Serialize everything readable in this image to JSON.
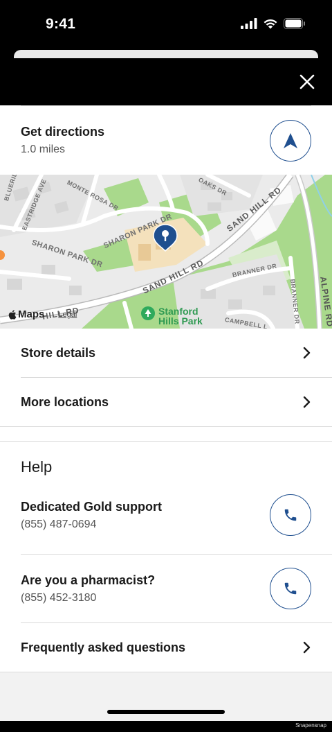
{
  "status_bar": {
    "time": "9:41"
  },
  "directions": {
    "title": "Get directions",
    "distance": "1.0 miles"
  },
  "map": {
    "labels": {
      "blueridge": "BLUERIDGE AVE",
      "eastridge": "EASTRIDGE AVE",
      "monte_rosa": "MONTE ROSA DR",
      "oaks": "OAKS DR",
      "sharon_park_1": "SHARON PARK DR",
      "sharon_park_2": "SHARON PARK DR",
      "sand_hill_1": "SAND HILL RD",
      "sand_hill_2": "SAND HILL RD",
      "sand_hill_3": "HILL RD",
      "branner_1": "BRANNER DR",
      "branner_2": "BRANNER DR",
      "campbell": "CAMPBELL L",
      "alpine": "ALPINE RD",
      "park_line1": "Stanford",
      "park_line2": "Hills Park"
    },
    "attribution": {
      "maps": "Maps",
      "legal": "Legal"
    }
  },
  "menu": {
    "store_details": "Store details",
    "more_locations": "More locations"
  },
  "help": {
    "heading": "Help",
    "gold_support": {
      "title": "Dedicated Gold support",
      "phone": "(855) 487-0694"
    },
    "pharmacist": {
      "title": "Are you a pharmacist?",
      "phone": "(855) 452-3180"
    },
    "faq": "Frequently asked questions"
  },
  "footer": {
    "watermark": "Snapensnap"
  },
  "colors": {
    "accent": "#1f4f8f",
    "pin": "#1f4f8f",
    "park_green": "#a9d98c"
  },
  "icons": [
    "cellular-icon",
    "wifi-icon",
    "battery-icon",
    "close-icon",
    "navigation-arrow-icon",
    "map-pin-icon",
    "chevron-right-icon",
    "phone-icon"
  ]
}
